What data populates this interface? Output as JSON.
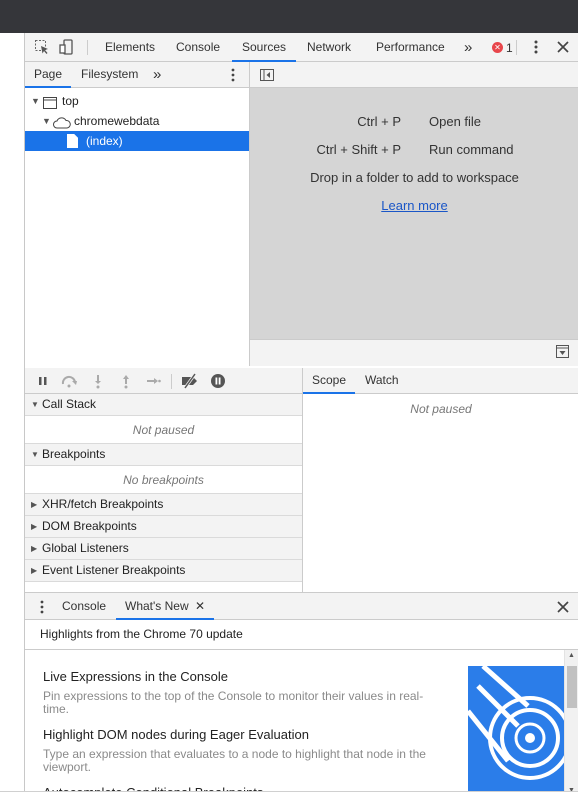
{
  "main_tabs": [
    "Elements",
    "Console",
    "Sources",
    "Network",
    "Performance"
  ],
  "active_main_tab": "Sources",
  "error_count": "1",
  "navigator": {
    "tabs": [
      "Page",
      "Filesystem"
    ],
    "tree": [
      "top",
      "chromewebdata",
      "(index)"
    ]
  },
  "editor": {
    "shortcuts": [
      {
        "key": "Ctrl + P",
        "action": "Open file"
      },
      {
        "key": "Ctrl + Shift + P",
        "action": "Run command"
      }
    ],
    "drop_text": "Drop in a folder to add to workspace",
    "learn_more": "Learn more"
  },
  "debugger": {
    "call_stack": "Call Stack",
    "call_stack_empty": "Not paused",
    "breakpoints": "Breakpoints",
    "breakpoints_empty": "No breakpoints",
    "xhr": "XHR/fetch Breakpoints",
    "dom": "DOM Breakpoints",
    "global": "Global Listeners",
    "event": "Event Listener Breakpoints"
  },
  "scope": {
    "tabs": [
      "Scope",
      "Watch"
    ],
    "empty": "Not paused"
  },
  "drawer": {
    "tabs": [
      "Console",
      "What's New"
    ],
    "highlights": "Highlights from the Chrome 70 update",
    "items": [
      {
        "title": "Live Expressions in the Console",
        "desc": "Pin expressions to the top of the Console to monitor their values in real-time."
      },
      {
        "title": "Highlight DOM nodes during Eager Evaluation",
        "desc": "Type an expression that evaluates to a node to highlight that node in the viewport."
      },
      {
        "title": "Autocomplete Conditional Breakpoints",
        "desc": ""
      }
    ]
  },
  "colors": {
    "accent": "#1a73e8",
    "error": "#e8464b",
    "titlebar": "#35363a",
    "whatsnew_image": "#2b7de9"
  },
  "icons": [
    "inspect-icon",
    "device-toolbar-icon",
    "more-tabs-icon",
    "error-icon",
    "kebab-menu-icon",
    "close-icon",
    "frame-icon",
    "cloud-icon",
    "file-icon",
    "toggle-navigator-icon",
    "pause-icon",
    "step-over-icon",
    "step-into-icon",
    "step-out-icon",
    "step-icon",
    "deactivate-breakpoints-icon",
    "pause-on-exceptions-icon"
  ]
}
